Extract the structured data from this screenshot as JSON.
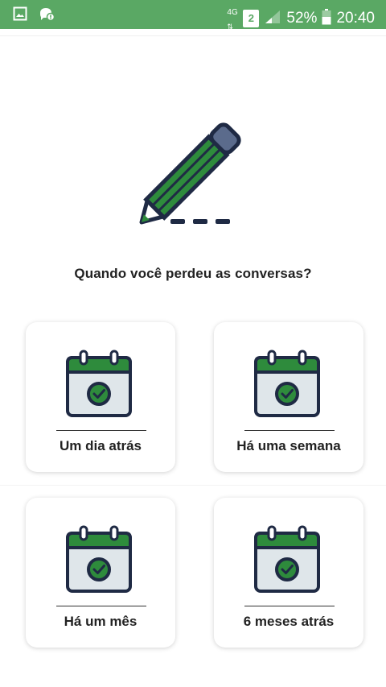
{
  "status_bar": {
    "network_top": "4G",
    "sim_badge": "2",
    "battery_percent": "52%",
    "time": "20:40",
    "icons": [
      "image-icon",
      "notification-icon",
      "data-arrows-icon",
      "signal-icon",
      "battery-icon"
    ]
  },
  "main": {
    "hero_icon": "pencil-icon",
    "question": "Quando você perdeu as conversas?",
    "options": [
      {
        "label": "Um dia atrás",
        "icon": "calendar-check-icon"
      },
      {
        "label": "Há uma semana",
        "icon": "calendar-check-icon"
      },
      {
        "label": "Há um mês",
        "icon": "calendar-check-icon"
      },
      {
        "label": "6 meses atrás",
        "icon": "calendar-check-icon"
      }
    ]
  },
  "colors": {
    "status_bar": "#5aa864",
    "accent_green": "#2e8b3c",
    "outline": "#1f2a44",
    "calendar_body": "#dfe6ea",
    "pencil_tip": "#5b6b8c"
  }
}
